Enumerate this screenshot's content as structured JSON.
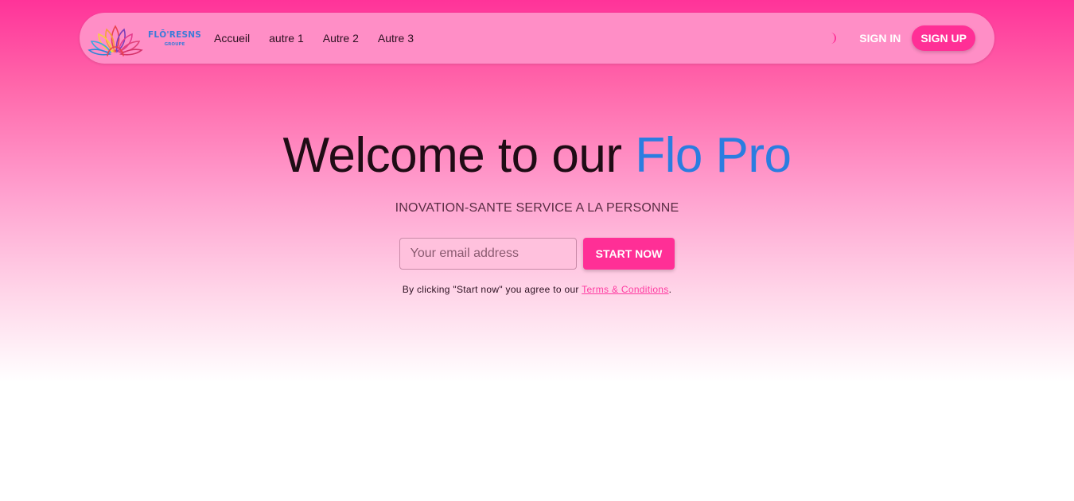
{
  "navbar": {
    "logo": {
      "name": "FLŌ'RESNS",
      "sub": "GROUPE"
    },
    "links": [
      "Accueil",
      "autre 1",
      "Autre 2",
      "Autre 3"
    ],
    "theme_icon": "crescent-moon-icon",
    "sign_in": "SIGN IN",
    "sign_up": "SIGN UP"
  },
  "hero": {
    "title_prefix": "Welcome to our ",
    "title_accent": "Flo Pro",
    "subtitle": "INOVATION-SANTE SERVICE A LA PERSONNE",
    "email_placeholder": "Your email address",
    "start_button": "START NOW",
    "terms_prefix": "By clicking \"Start now\" you agree to our ",
    "terms_link": "Terms & Conditions",
    "terms_suffix": "."
  },
  "colors": {
    "accent": "#ff2f96",
    "title_accent": "#2b7de0",
    "logo_text": "#3d7bd8"
  }
}
